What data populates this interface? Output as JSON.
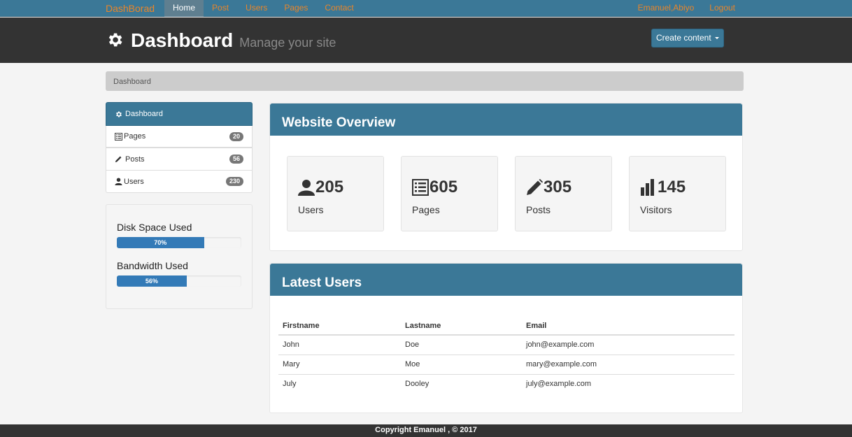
{
  "nav": {
    "brand": "DashBorad",
    "links": [
      "Home",
      "Post",
      "Users",
      "Pages",
      "Contact"
    ],
    "user": "Emanuel,Abiyo",
    "logout": "Logout"
  },
  "header": {
    "title": "Dashboard",
    "subtitle": "Manage your site",
    "create_button": "Create content"
  },
  "breadcrumb": "Dashboard",
  "sidebar": {
    "active": "Dashboard",
    "items": [
      {
        "label": "Pages",
        "count": "20",
        "icon": "list-icon"
      },
      {
        "label": "Posts",
        "count": "56",
        "icon": "pencil-icon"
      },
      {
        "label": "Users",
        "count": "230",
        "icon": "user-icon"
      }
    ]
  },
  "usage": {
    "disk_label": "Disk Space Used",
    "disk_value": "70%",
    "disk_fraction": 0.7,
    "bandwidth_label": "Bandwidth Used",
    "bandwidth_value": "56%",
    "bandwidth_fraction": 0.56
  },
  "overview": {
    "title": "Website Overview",
    "stats": [
      {
        "value": "205",
        "label": "Users",
        "icon": "user-icon"
      },
      {
        "value": "605",
        "label": "Pages",
        "icon": "list-icon"
      },
      {
        "value": "305",
        "label": "Posts",
        "icon": "pencil-icon"
      },
      {
        "value": "145",
        "label": "Visitors",
        "icon": "bar-chart-icon"
      }
    ]
  },
  "latest_users": {
    "title": "Latest Users",
    "columns": [
      "Firstname",
      "Lastname",
      "Email"
    ],
    "rows": [
      [
        "John",
        "Doe",
        "john@example.com"
      ],
      [
        "Mary",
        "Moe",
        "mary@example.com"
      ],
      [
        "July",
        "Dooley",
        "july@example.com"
      ]
    ]
  },
  "footer": "Copyright Emanuel , © 2017",
  "colors": {
    "primary": "#3b7897",
    "brand_orange": "#e8852a",
    "header_dark": "#333333",
    "progress": "#337ab7"
  }
}
